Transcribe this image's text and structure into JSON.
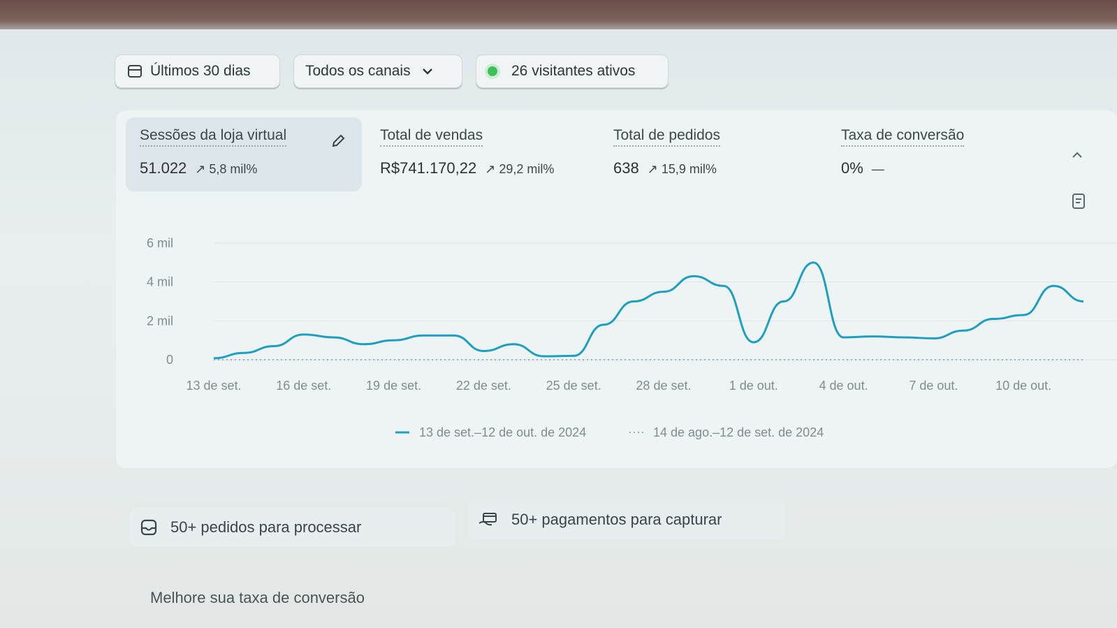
{
  "filters": {
    "date_range": "Últimos 30 dias",
    "channels": "Todos os canais",
    "active_visitors": "26 visitantes ativos"
  },
  "metrics": [
    {
      "title": "Sessões da loja virtual",
      "value": "51.022",
      "change": "5,8 mil%",
      "trend": "up",
      "active": true
    },
    {
      "title": "Total de vendas",
      "value": "R$741.170,22",
      "change": "29,2 mil%",
      "trend": "up"
    },
    {
      "title": "Total de pedidos",
      "value": "638",
      "change": "15,9 mil%",
      "trend": "up"
    },
    {
      "title": "Taxa de conversão",
      "value": "0%",
      "change": "—",
      "trend": "flat"
    }
  ],
  "chart_data": {
    "type": "line",
    "y_ticks": [
      "6 mil",
      "4 mil",
      "2 mil",
      "0"
    ],
    "ylim": [
      0,
      6000
    ],
    "x_ticks": [
      "13 de set.",
      "16 de set.",
      "19 de set.",
      "22 de set.",
      "25 de set.",
      "28 de set.",
      "1 de out.",
      "4 de out.",
      "7 de out.",
      "10 de out."
    ],
    "x": [
      "13 de set.",
      "14 de set.",
      "15 de set.",
      "16 de set.",
      "17 de set.",
      "18 de set.",
      "19 de set.",
      "20 de set.",
      "21 de set.",
      "22 de set.",
      "23 de set.",
      "24 de set.",
      "25 de set.",
      "26 de set.",
      "27 de set.",
      "28 de set.",
      "29 de set.",
      "30 de set.",
      "1 de out.",
      "2 de out.",
      "3 de out.",
      "4 de out.",
      "5 de out.",
      "6 de out.",
      "7 de out.",
      "8 de out.",
      "9 de out.",
      "10 de out.",
      "11 de out.",
      "12 de out."
    ],
    "series": [
      {
        "name": "13 de set.–12 de out. de 2024",
        "style": "solid",
        "values": [
          80,
          350,
          700,
          1300,
          1150,
          800,
          1000,
          1250,
          1250,
          450,
          800,
          180,
          200,
          1800,
          3000,
          3500,
          4300,
          3800,
          900,
          3000,
          5000,
          1150,
          1200,
          1150,
          1100,
          1500,
          2100,
          2300,
          3800,
          3000
        ]
      },
      {
        "name": "14 de ago.–12 de set. de 2024",
        "style": "dotted",
        "values": [
          0,
          0,
          0,
          0,
          0,
          0,
          0,
          0,
          0,
          0,
          0,
          0,
          0,
          0,
          0,
          0,
          0,
          0,
          0,
          0,
          0,
          0,
          0,
          0,
          0,
          0,
          0,
          0,
          0,
          0
        ]
      }
    ],
    "colors": {
      "current": "#1f9fc0",
      "previous": "#8fb3bd"
    }
  },
  "tasks": {
    "orders": "50+ pedidos para processar",
    "payments": "50+ pagamentos para capturar"
  },
  "section_title": "Melhore sua taxa de conversão"
}
